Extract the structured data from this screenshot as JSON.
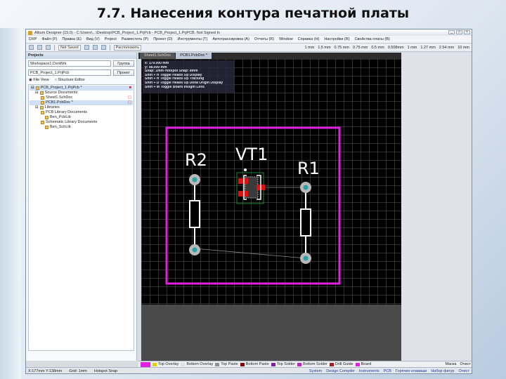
{
  "slide": {
    "title": "7.7. Нанесения контура печатной платы"
  },
  "window": {
    "title": "Altium Designer (15.0) - C:\\Users\\...\\Desktop\\PCB_Project_1.PrjPcb - PCB_Project_1.PrjPCB. Not Signed In",
    "controls": [
      "_",
      "□",
      "×"
    ]
  },
  "menu": [
    "DXP",
    "Файл (F)",
    "Правка (E)",
    "Вид (V)",
    "Project",
    "Разместить (P)",
    "Проект (D)",
    "Инструменты (T)",
    "Автотрассировка (A)",
    "Отчеты (R)",
    "Window",
    "Справка (H)",
    "Настройки (R)",
    "Свойства платы (B)"
  ],
  "toolbar": {
    "combo1": "Not Saved",
    "combo2": "Расположить",
    "right_values": [
      "1 mm",
      "1.5 mm",
      "0.75 mm",
      "0.75 mm",
      "0.5 mm",
      "0.508mm",
      "1 mm",
      "1.27 mm",
      "2.54 mm",
      "10 mm"
    ]
  },
  "projects_panel": {
    "title": "Projects",
    "workspace": "Workspace1.DsnWrk",
    "workspace_button": "Группа",
    "project": "PCB_Project_1.PrjPcb",
    "project_button": "Проект",
    "view_file": "File View",
    "view_structure": "Structure Editor",
    "tree": [
      {
        "label": "PCB_Project_1.PrjPcb *",
        "indent": 0,
        "flag": "■",
        "selected": true
      },
      {
        "label": "Source Documents",
        "indent": 1,
        "flag": "",
        "selected": false
      },
      {
        "label": "Sheet1.SchDoc",
        "indent": 2,
        "flag": "▢",
        "selected": false
      },
      {
        "label": "PCB1.PcbDoc *",
        "indent": 2,
        "flag": "▢",
        "selected": true
      },
      {
        "label": "Libraries",
        "indent": 1,
        "flag": "",
        "selected": false
      },
      {
        "label": "PCB Library Documents",
        "indent": 2,
        "flag": "",
        "selected": false
      },
      {
        "label": "Ben_PcbLib",
        "indent": 3,
        "flag": "",
        "selected": false
      },
      {
        "label": "Schematic Library Documents",
        "indent": 2,
        "flag": "",
        "selected": false
      },
      {
        "label": "Ben_SchLib",
        "indent": 3,
        "flag": "",
        "selected": false
      }
    ]
  },
  "doc_tabs": [
    "Sheet1.SchDoc",
    "PCB1.PcbDoc *"
  ],
  "board_info": {
    "lines": [
      "x: 179.000 mm",
      "y: 98.000 mm",
      "Snap: 1mm Hotspot Snap: 8mm",
      "Shift + H  Toggle Heads Up Display",
      "Shift + H  Toggle Heads Up Tracking",
      "Shift + D  Toggle Heads Up Delta Origin Display",
      "Shift + M  Toggle Board Insight Lens"
    ]
  },
  "designators": {
    "r2": "R2",
    "vt1": "VT1",
    "r1": "R1"
  },
  "colors": {
    "board_outline": "#e020e0",
    "copper": "#e01010",
    "silkscreen": "#ffffff",
    "pad_ring": "#b8b8b8",
    "pad_hole": "#2aa0a0"
  },
  "layer_tabs": [
    {
      "label": "Top Overlay",
      "color": "#e8d000"
    },
    {
      "label": "Bottom Overlay",
      "color": "#e0e0e0"
    },
    {
      "label": "Top Paste",
      "color": "#909090"
    },
    {
      "label": "Bottom Paste",
      "color": "#800000"
    },
    {
      "label": "Top Solder",
      "color": "#8020a0"
    },
    {
      "label": "Bottom Solder",
      "color": "#c020c0"
    },
    {
      "label": "Drill Guide",
      "color": "#a02020"
    },
    {
      "label": "Board",
      "color": "#e020e0"
    }
  ],
  "layer_tab_right": [
    "Маска",
    "Очист"
  ],
  "statusbar": {
    "coords": "X:177mm Y:138mm",
    "grid": "Grid: 1mm",
    "hotspot": "Hotspot Snap",
    "right_items": [
      "System",
      "Design Compiler",
      "Instruments",
      "PCB",
      "Горячие клавиши",
      "Набор фигур",
      "Очист"
    ]
  }
}
